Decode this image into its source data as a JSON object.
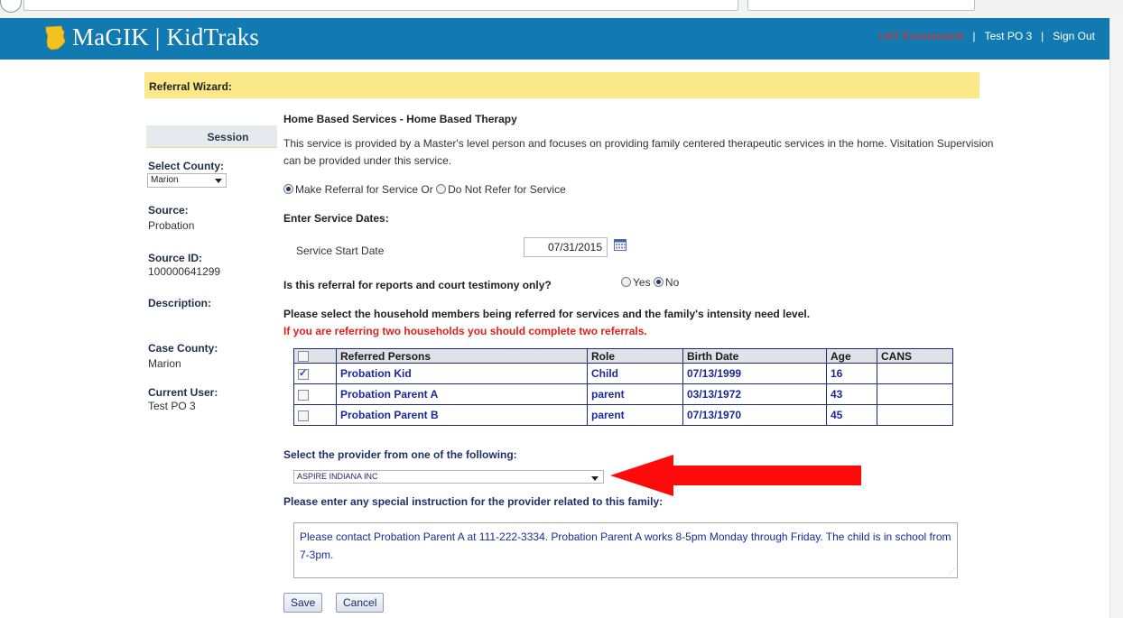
{
  "header": {
    "app_name": "MaGIK | KidTraks",
    "environment": "UAT Environment",
    "user_link": "Test PO 3",
    "signout_link": "Sign Out",
    "sep1": "|",
    "sep2": "|"
  },
  "wizard": {
    "title": "Referral Wizard:"
  },
  "session": {
    "heading": "Session",
    "county_label": "Select County:",
    "county_value": "Marion",
    "source_label": "Source:",
    "source_value": "Probation",
    "source_id_label": "Source ID:",
    "source_id_value": "100000641299",
    "description_label": "Description:",
    "case_county_label": "Case County:",
    "case_county_value": "Marion",
    "current_user_label": "Current User:",
    "current_user_value": "Test PO 3"
  },
  "service": {
    "title": "Home Based Services - Home Based Therapy",
    "description": "This service is provided by a Master's level person and focuses on providing family centered therapeutic services in the home. Visitation Supervision can be provided under this service.",
    "make_referral_label": "Make Referral for Service Or",
    "do_not_refer_label": "Do Not Refer for Service",
    "dates_heading": "Enter Service Dates:",
    "start_date_label": "Service Start Date",
    "start_date_value": "07/31/2015",
    "court_question": "Is this referral for reports and court testimony only?",
    "yes_label": "Yes",
    "no_label": "No",
    "household_question": "Please select the household members being referred for services and the family's intensity need level.",
    "household_warning": "If you are referring two households you should complete two referrals."
  },
  "persons_table": {
    "headers": [
      "Referred Persons",
      "Role",
      "Birth Date",
      "Age",
      "CANS"
    ],
    "rows": [
      {
        "name": "Probation Kid",
        "role": "Child",
        "birth": "07/13/1999",
        "age": "16",
        "cans": "",
        "checked": true
      },
      {
        "name": "Probation Parent A",
        "role": "parent",
        "birth": "03/13/1972",
        "age": "43",
        "cans": "",
        "checked": false
      },
      {
        "name": "Probation Parent B",
        "role": "parent",
        "birth": "07/13/1970",
        "age": "45",
        "cans": "",
        "checked": false
      }
    ]
  },
  "provider": {
    "question": "Select the provider from one of the following:",
    "selected": "ASPIRE INDIANA INC"
  },
  "special": {
    "question": "Please enter any special instruction for the provider related to this family:",
    "text": "Please contact Probation Parent A at 111-222-3334.  Probation Parent A works 8-5pm Monday through Friday.  The child is in school from 7-3pm."
  },
  "buttons": {
    "save": "Save",
    "cancel": "Cancel"
  },
  "colors": {
    "header_bg": "#117ab0",
    "wizard_bg": "#fae889",
    "warning": "#e0201a",
    "arrow": "#ff0000",
    "table_text": "#1a2a99"
  },
  "icons": {
    "logo": "indiana-state-icon",
    "calendar": "calendar-icon",
    "dropdown": "chevron-down-icon"
  }
}
